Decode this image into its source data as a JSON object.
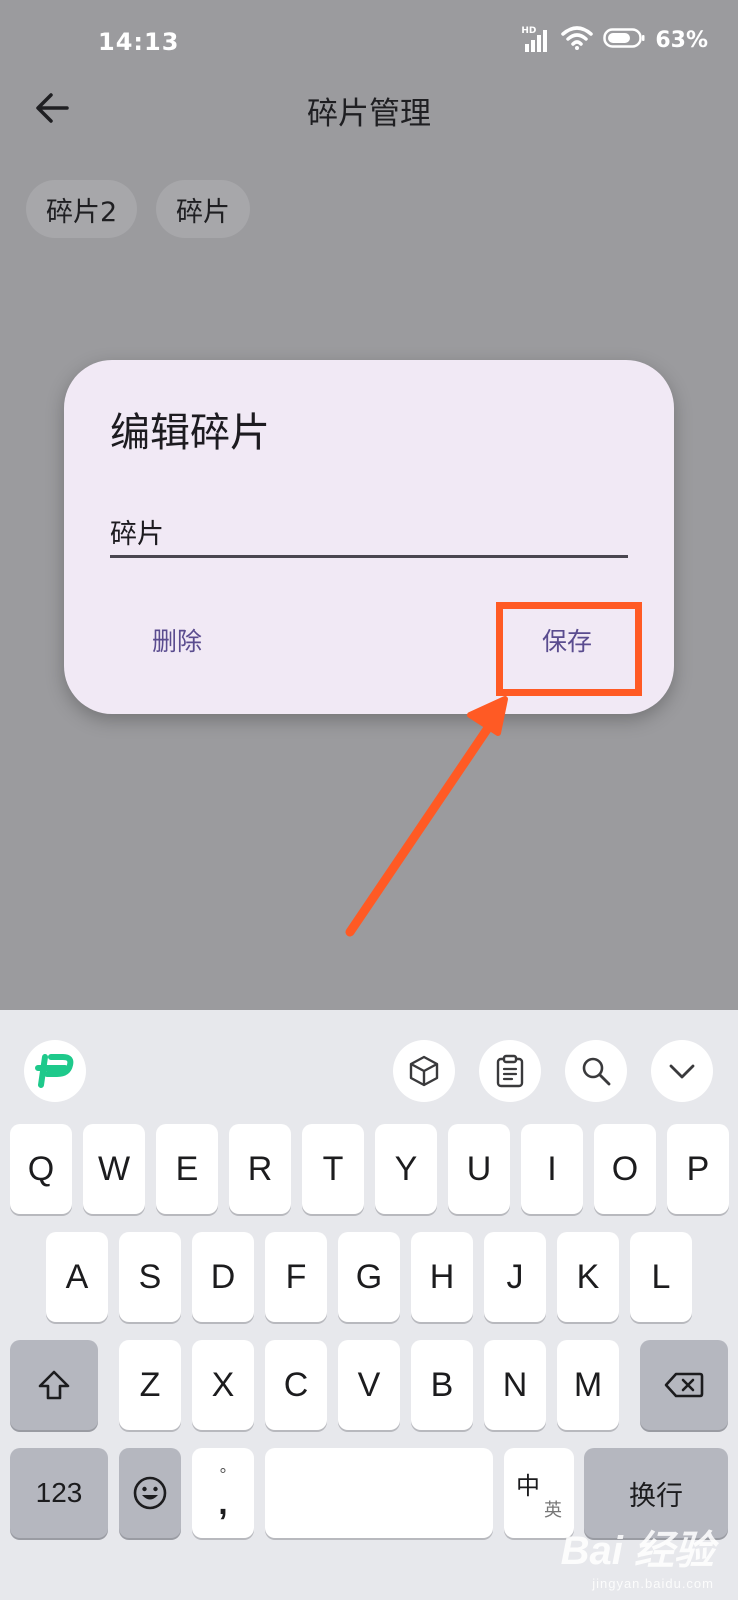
{
  "status_bar": {
    "time": "14:13",
    "network": "HD",
    "battery": "63%"
  },
  "app_bar": {
    "title": "碎片管理"
  },
  "chips": [
    {
      "label": "碎片2"
    },
    {
      "label": "碎片"
    }
  ],
  "dialog": {
    "title": "编辑碎片",
    "field_value": "碎片",
    "delete_label": "删除",
    "save_label": "保存"
  },
  "colors": {
    "annotation": "#ff5a24",
    "dialog_bg": "#f1e9f5",
    "action_text": "#5a4c8f",
    "logo_green": "#1ec98b"
  },
  "keyboard": {
    "toolbar_icons": [
      "logo-icon",
      "cube-icon",
      "clipboard-icon",
      "search-icon",
      "chevron-down-icon"
    ],
    "row1": [
      "Q",
      "W",
      "E",
      "R",
      "T",
      "Y",
      "U",
      "I",
      "O",
      "P"
    ],
    "row2": [
      "A",
      "S",
      "D",
      "F",
      "G",
      "H",
      "J",
      "K",
      "L"
    ],
    "row3": [
      "Z",
      "X",
      "C",
      "V",
      "B",
      "N",
      "M"
    ],
    "numbers_label": "123",
    "punct_top": "°",
    "punct_bottom": ",",
    "lang_zh": "中",
    "lang_en": "英",
    "enter_label": "换行"
  },
  "watermark": {
    "main": "Bai 经验",
    "sub": "jingyan.baidu.com"
  }
}
